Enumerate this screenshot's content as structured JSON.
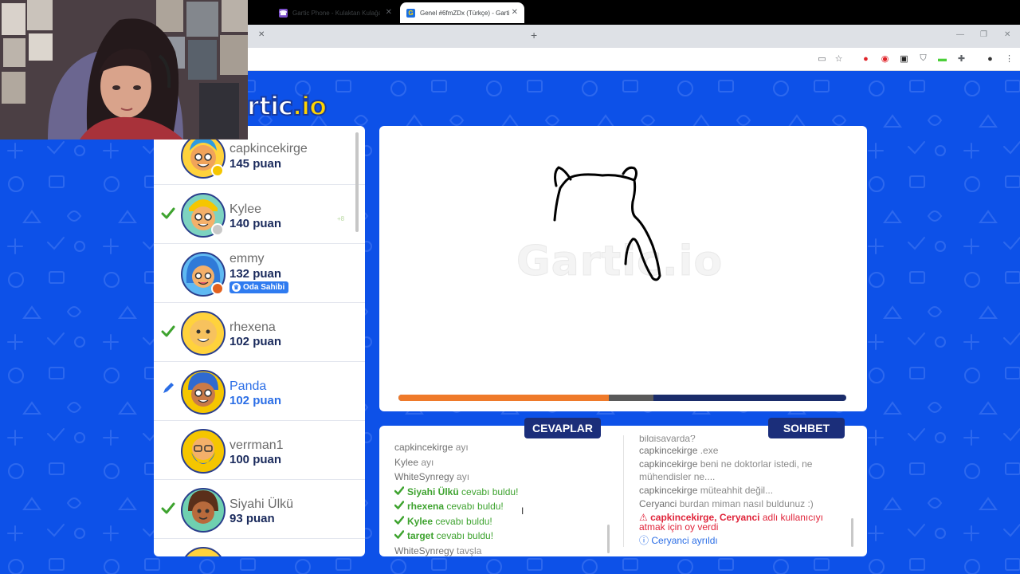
{
  "browser": {
    "tabs": [
      {
        "title": "Gartic Phone - Kulaktan Kulağa",
        "favicon": "gartic-phone-icon",
        "active": false
      },
      {
        "title": "Genel #6fmZDx (Türkçe) - Gartic",
        "favicon": "gartic-io-icon",
        "active": true
      }
    ],
    "toolbar_icons": [
      "cast-icon",
      "star-icon",
      "opera-icon",
      "record-icon",
      "extension-icon",
      "shield-icon",
      "battery-icon",
      "puzzle-icon",
      "profile-icon",
      "menu-icon"
    ]
  },
  "logo": {
    "text": "rtic",
    "suffix": ".io"
  },
  "players": [
    {
      "name": "capkincekirge",
      "points": "145 puan",
      "guessed": false,
      "drawing": false,
      "status_color": "#f5c600"
    },
    {
      "name": "Kylee",
      "points": "140 puan",
      "guessed": true,
      "drawing": false,
      "status_color": "#c8c8c8",
      "gain": "+8"
    },
    {
      "name": "emmy",
      "points": "132 puan",
      "guessed": false,
      "drawing": false,
      "status_color": "#e3611e",
      "badge": "Oda Sahibi"
    },
    {
      "name": "rhexena",
      "points": "102 puan",
      "guessed": true,
      "drawing": false
    },
    {
      "name": "Panda",
      "points": "102 puan",
      "guessed": false,
      "drawing": true
    },
    {
      "name": "verrman1",
      "points": "100 puan",
      "guessed": false,
      "drawing": false
    },
    {
      "name": "Siyahi Ülkü",
      "points": "93 puan",
      "guessed": true,
      "drawing": false
    }
  ],
  "canvas": {
    "watermark": "Gartic.io",
    "timer_progress": 0.47,
    "timer_gray_end": 0.57
  },
  "answers": {
    "title": "CEVAPLAR",
    "items": [
      {
        "user": "capkincekirge",
        "text": "ayı",
        "correct": false
      },
      {
        "user": "Kylee",
        "text": "ayı",
        "correct": false
      },
      {
        "user": "WhiteSynregy",
        "text": "ayı",
        "correct": false
      },
      {
        "user": "Siyahi Ülkü",
        "text": "cevabı buldu!",
        "correct": true
      },
      {
        "user": "rhexena",
        "text": "cevabı buldu!",
        "correct": true
      },
      {
        "user": "Kylee",
        "text": "cevabı buldu!",
        "correct": true
      },
      {
        "user": "target",
        "text": "cevabı buldu!",
        "correct": true
      },
      {
        "user": "WhiteSynregy",
        "text": "tavşla",
        "correct": false
      }
    ]
  },
  "chat": {
    "title": "SOHBET",
    "partial_top": "bilgisayarda?",
    "items": [
      {
        "user": "capkincekirge",
        "text": ".exe"
      },
      {
        "user": "capkincekirge",
        "text": "beni ne doktorlar istedi, ne mühendisler ne...."
      },
      {
        "user": "capkincekirge",
        "text": "müteahhit değil..."
      },
      {
        "user": "Ceryanci",
        "text": "burdan miman nasıl buldunuz :)"
      }
    ],
    "warning": {
      "users": "capkincekirge, Ceryanci",
      "text": "adlı kullanıcıyı atmak için oy verdi"
    },
    "info": {
      "user": "Ceryanci",
      "text": "ayrıldı"
    }
  },
  "colors": {
    "page_bg": "#0d51e8",
    "header_bg": "#1b2e7a",
    "correct": "#3ea32f",
    "drawer": "#2b6ee6",
    "warning": "#e0243a",
    "timer_fill": "#ef7a2a"
  }
}
